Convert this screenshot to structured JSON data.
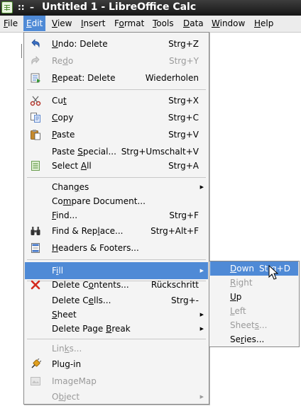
{
  "window": {
    "title": "Untitled 1 - LibreOffice Calc",
    "buttons": [
      "::",
      "–"
    ]
  },
  "menubar": {
    "items": [
      {
        "label": "File",
        "u": "F",
        "rest": "ile"
      },
      {
        "label": "Edit",
        "u": "E",
        "rest": "dit"
      },
      {
        "label": "View",
        "u": "V",
        "rest": "iew"
      },
      {
        "label": "Insert",
        "u": "I",
        "rest": "nsert"
      },
      {
        "label": "Format",
        "u": "o",
        "pre": "F",
        "rest": "rmat"
      },
      {
        "label": "Tools",
        "u": "T",
        "rest": "ools"
      },
      {
        "label": "Data",
        "u": "D",
        "rest": "ata"
      },
      {
        "label": "Window",
        "u": "W",
        "rest": "indow"
      },
      {
        "label": "Help",
        "u": "H",
        "rest": "elp"
      }
    ]
  },
  "edit_menu": {
    "items": [
      {
        "pre": "",
        "u": "U",
        "post": "ndo: Delete",
        "accel": "Strg+Z",
        "icon": "undo-icon",
        "disabled": false
      },
      {
        "pre": "Re",
        "u": "d",
        "post": "o",
        "accel": "Strg+Y",
        "icon": "redo-icon",
        "disabled": true
      },
      {
        "pre": "",
        "u": "R",
        "post": "epeat: Delete",
        "accel": "Wiederholen",
        "icon": "repeat-icon",
        "disabled": false
      },
      {
        "pre": "Cu",
        "u": "t",
        "post": "",
        "accel": "Strg+X",
        "icon": "scissors-icon",
        "disabled": false
      },
      {
        "pre": "",
        "u": "C",
        "post": "opy",
        "accel": "Strg+C",
        "icon": "copy-icon",
        "disabled": false
      },
      {
        "pre": "",
        "u": "P",
        "post": "aste",
        "accel": "Strg+V",
        "icon": "paste-icon",
        "disabled": false
      },
      {
        "pre": "Paste ",
        "u": "S",
        "post": "pecial...",
        "accel": "Strg+Umschalt+V",
        "icon": "",
        "disabled": false
      },
      {
        "pre": "Select ",
        "u": "A",
        "post": "ll",
        "accel": "Strg+A",
        "icon": "select-all-icon",
        "disabled": false
      },
      {
        "pre": "Chan",
        "u": "g",
        "post": "es",
        "accel": "",
        "icon": "",
        "disabled": false,
        "submenu": true
      },
      {
        "pre": "Co",
        "u": "m",
        "post": "pare Document...",
        "accel": "",
        "icon": "",
        "disabled": false
      },
      {
        "pre": "",
        "u": "F",
        "post": "ind...",
        "accel": "Strg+F",
        "icon": "",
        "disabled": false
      },
      {
        "pre": "Find & Rep",
        "u": "l",
        "post": "ace...",
        "accel": "Strg+Alt+F",
        "icon": "binoculars-icon",
        "disabled": false
      },
      {
        "pre": "",
        "u": "H",
        "post": "eaders & Footers...",
        "accel": "",
        "icon": "headers-footers-icon",
        "disabled": false
      },
      {
        "pre": "F",
        "u": "i",
        "post": "ll",
        "accel": "",
        "icon": "",
        "disabled": false,
        "submenu": true,
        "highlighted": true
      },
      {
        "pre": "Delete C",
        "u": "o",
        "post": "ntents...",
        "accel": "Rückschritt",
        "icon": "delete-x-icon",
        "disabled": false
      },
      {
        "pre": "Delete C",
        "u": "e",
        "post": "lls...",
        "accel": "Strg+-",
        "icon": "",
        "disabled": false
      },
      {
        "pre": "",
        "u": "S",
        "post": "heet",
        "accel": "",
        "icon": "",
        "disabled": false,
        "submenu": true
      },
      {
        "pre": "Delete Page ",
        "u": "B",
        "post": "reak",
        "accel": "",
        "icon": "",
        "disabled": false,
        "submenu": true
      },
      {
        "pre": "Lin",
        "u": "k",
        "post": "s...",
        "accel": "",
        "icon": "",
        "disabled": true
      },
      {
        "pre": "Plu",
        "u": "g",
        "post": "-in",
        "accel": "",
        "icon": "plugin-icon",
        "disabled": false
      },
      {
        "pre": "ImageMap",
        "u": "",
        "post": "",
        "accel": "",
        "icon": "imagemap-icon",
        "disabled": true
      },
      {
        "pre": "O",
        "u": "b",
        "post": "ject",
        "accel": "",
        "icon": "",
        "disabled": true,
        "submenu": true
      }
    ]
  },
  "fill_submenu": {
    "items": [
      {
        "pre": "",
        "u": "D",
        "post": "own",
        "accel": "Strg+D",
        "disabled": false,
        "highlighted": true
      },
      {
        "pre": "",
        "u": "R",
        "post": "ight",
        "accel": "",
        "disabled": true
      },
      {
        "pre": "",
        "u": "U",
        "post": "p",
        "accel": "",
        "disabled": false
      },
      {
        "pre": "",
        "u": "L",
        "post": "eft",
        "accel": "",
        "disabled": true
      },
      {
        "pre": "Sheet",
        "u": "s",
        "post": "...",
        "accel": "",
        "disabled": true
      },
      {
        "pre": "Se",
        "u": "r",
        "post": "ies...",
        "accel": "",
        "disabled": false
      }
    ]
  },
  "colors": {
    "highlight": "#4f8ad6",
    "menu_bg": "#f4f4f4",
    "titlebar": "#1e1e1e",
    "disabled_text": "#9a9a9a"
  }
}
